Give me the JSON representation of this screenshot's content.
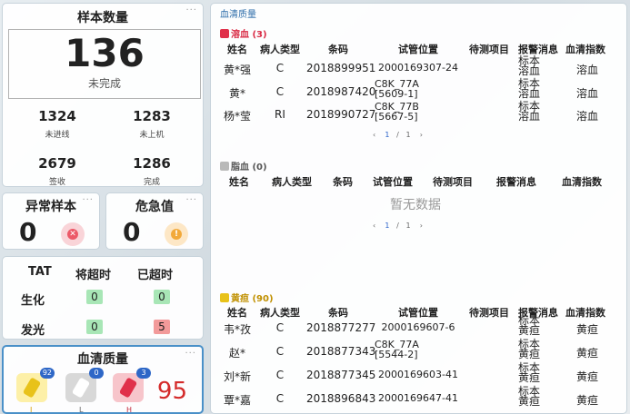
{
  "sample_count": {
    "title": "样本数量",
    "main_value": "136",
    "main_label": "未完成",
    "stats": [
      {
        "value": "1324",
        "label": "未进线"
      },
      {
        "value": "1283",
        "label": "未上机"
      },
      {
        "value": "2679",
        "label": "签收"
      },
      {
        "value": "1286",
        "label": "完成"
      }
    ],
    "more": "···"
  },
  "abnormal": {
    "title": "异常样本",
    "value": "0",
    "more": "···"
  },
  "critical": {
    "title": "危急值",
    "value": "0",
    "more": "···"
  },
  "tat": {
    "headers": [
      "TAT",
      "将超时",
      "已超时"
    ],
    "rows": [
      {
        "label": "生化",
        "near": "0",
        "over": "0"
      },
      {
        "label": "发光",
        "near": "0",
        "over": "5"
      }
    ]
  },
  "serum_quality": {
    "title": "血清质量",
    "more": "···",
    "tubes": [
      {
        "badge": "92",
        "label": "I"
      },
      {
        "badge": "0",
        "label": "L"
      },
      {
        "badge": "3",
        "label": "H"
      }
    ],
    "value": "95"
  },
  "right_panel": {
    "title": "血清质量",
    "columns": [
      "姓名",
      "病人类型",
      "条码",
      "试管位置",
      "待测项目",
      "报警消息",
      "血清指数"
    ],
    "hemolysis": {
      "label": "溶血 (3)",
      "rows": [
        {
          "name": "黄*强",
          "type": "C",
          "barcode": "2018899951",
          "pos": "2000169307-24",
          "pending": "",
          "alarm": "标本溶血",
          "index": "溶血"
        },
        {
          "name": "黄*",
          "type": "C",
          "barcode": "2018987420",
          "pos": "C8K_77A [5609-1]",
          "pending": "",
          "alarm": "标本溶血",
          "index": "溶血"
        },
        {
          "name": "杨*莹",
          "type": "RI",
          "barcode": "2018990727",
          "pos": "C8K_77B [5667-5]",
          "pending": "",
          "alarm": "标本溶血",
          "index": "溶血"
        }
      ],
      "pager": {
        "prev": "‹",
        "page": "1",
        "sep": "/",
        "total": "1",
        "next": "›"
      }
    },
    "lipemia": {
      "label": "脂血 (0)",
      "empty": "暂无数据",
      "pager": {
        "prev": "‹",
        "page": "1",
        "sep": "/",
        "total": "1",
        "next": "›"
      }
    },
    "icterus": {
      "label": "黄疸 (90)",
      "rows": [
        {
          "name": "韦*孜",
          "type": "C",
          "barcode": "2018877277",
          "pos": "2000169607-6",
          "pending": "",
          "alarm": "标本黄疸",
          "index": "黄疸"
        },
        {
          "name": "赵*",
          "type": "C",
          "barcode": "2018877343",
          "pos": "C8K_77A [5544-2]",
          "pending": "",
          "alarm": "标本黄疸",
          "index": "黄疸"
        },
        {
          "name": "刘*新",
          "type": "C",
          "barcode": "2018877345",
          "pos": "2000169603-41",
          "pending": "",
          "alarm": "标本黄疸",
          "index": "黄疸"
        },
        {
          "name": "覃*嘉",
          "type": "C",
          "barcode": "2018896843",
          "pos": "2000169647-41",
          "pending": "",
          "alarm": "标本黄疸",
          "index": "黄疸"
        }
      ]
    }
  },
  "colors": {
    "accent": "#2f6eaa",
    "danger": "#d42a2a",
    "ok": "#a8e6b6",
    "warn": "#f29a9a",
    "hemolysis": "#e0304a",
    "icterus": "#e8c21a",
    "lipemia": "#b9b9b9"
  },
  "icons": {
    "abnormal": "close-circle-icon",
    "critical": "alert-circle-icon",
    "tube": "test-tube-icon"
  }
}
